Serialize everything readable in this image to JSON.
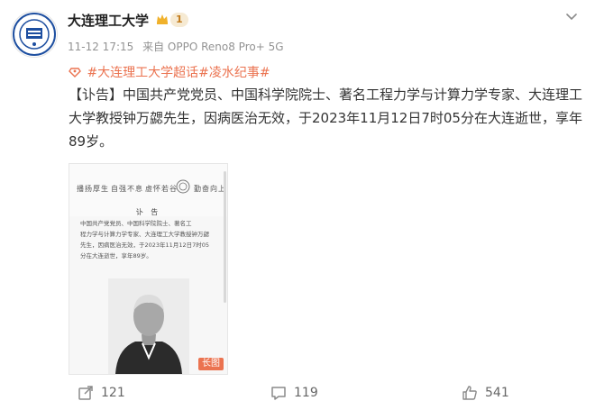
{
  "post": {
    "author_name": "大连理工大学",
    "badge_level": "1",
    "timestamp": "11-12 17:15",
    "source": "来自 OPPO Reno8 Pro+ 5G",
    "topic_line": "#大连理工大学超话#凌水纪事#",
    "text": "【讣告】中国共产党党员、中国科学院院士、著名工程力学与计算力学专家、大连理工大学教授钟万勰先生，因病医治无效，于2023年11月12日7时05分在大连逝世，享年89岁。"
  },
  "image_card": {
    "calligraphy_1": "播扬厚生",
    "calligraphy_2": "自强不息",
    "calligraphy_3": "虚怀若谷",
    "calligraphy_4": "勤奋向上",
    "title": "讣  告",
    "body_lines": [
      "中国共产党党员、中国科学院院士、著名工",
      "程力学与计算力学专家、大连理工大学教授钟万勰",
      "先生，因病医治无效，于2023年11月12日7时05",
      "分在大连逝世，享年89岁。"
    ],
    "long_image_label": "长图"
  },
  "actions": {
    "share_count": "121",
    "comment_count": "119",
    "like_count": "541"
  },
  "colors": {
    "accent": "#eb7350",
    "text": "#333333",
    "muted": "#939393"
  },
  "icons": [
    "avatar-logo",
    "crown-icon",
    "chevron-down-icon",
    "topic-icon",
    "share-icon",
    "comment-icon",
    "like-icon"
  ]
}
